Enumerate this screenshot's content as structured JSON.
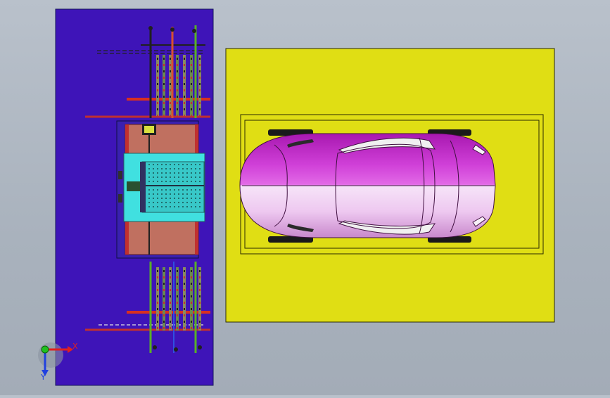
{
  "viewport": {
    "background_top": "#b9c1cb",
    "background_bottom": "#a3acb7"
  },
  "model": {
    "machine_panel": {
      "color": "#3e14b8",
      "outline": "#14145a"
    },
    "car_panel": {
      "color": "#e0de14",
      "outline": "#2a2a00"
    },
    "car": {
      "body_color": "#c030c8",
      "highlight_color": "#f2d8f4",
      "roof_color": "#e070e8"
    },
    "trolley": {
      "base_color": "#c07060",
      "carriage_color": "#40e0e0",
      "rail_color": "#c03030"
    },
    "guide_rail_colors": {
      "red": "#d83020",
      "green": "#58b028",
      "dark": "#202020",
      "blue": "#3050e0"
    }
  },
  "triad": {
    "x_label": "X",
    "y_label": "Y",
    "x_color": "#e02020",
    "y_color": "#2040e0",
    "origin_color": "#20c020"
  }
}
